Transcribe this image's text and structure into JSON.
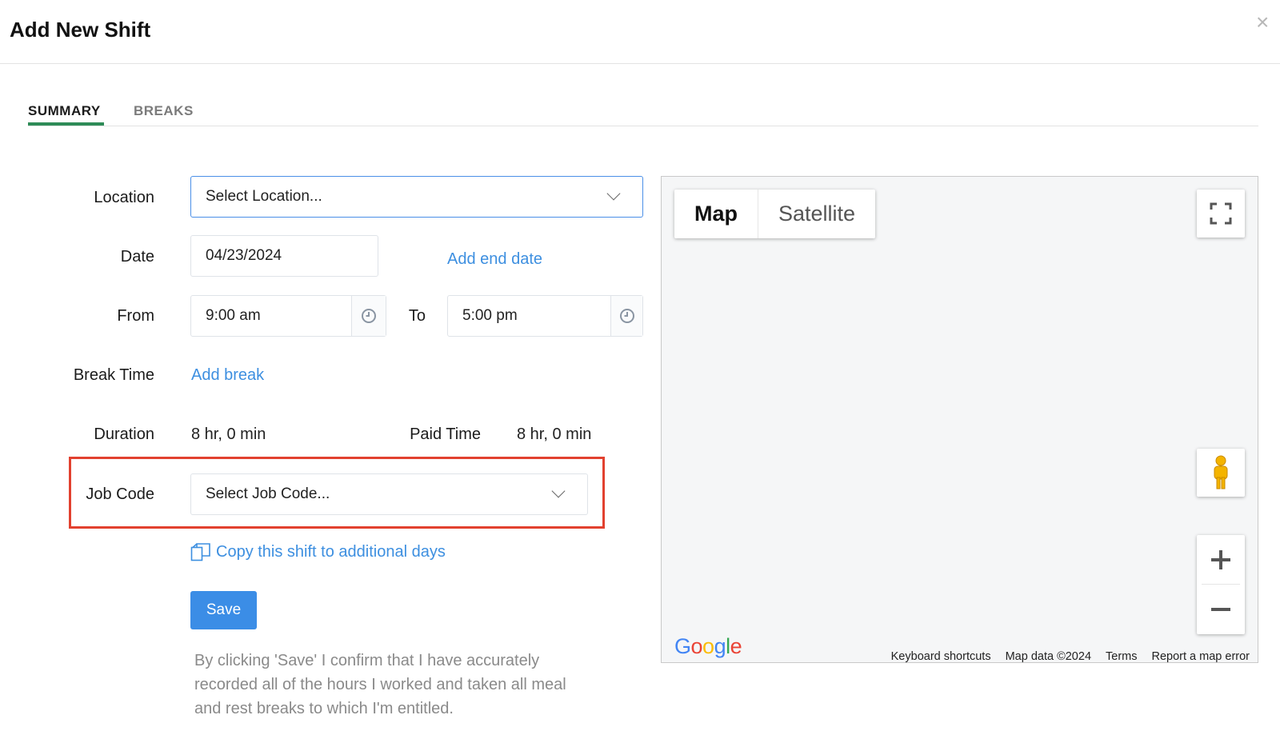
{
  "header": {
    "title": "Add New Shift",
    "close_symbol": "×"
  },
  "tabs": [
    {
      "label": "SUMMARY",
      "active": true
    },
    {
      "label": "BREAKS",
      "active": false
    }
  ],
  "form": {
    "location": {
      "label": "Location",
      "placeholder": "Select Location..."
    },
    "date": {
      "label": "Date",
      "value": "04/23/2024",
      "add_end_date": "Add end date"
    },
    "from": {
      "label": "From",
      "value": "9:00 am"
    },
    "to": {
      "label": "To",
      "value": "5:00 pm"
    },
    "break_time": {
      "label": "Break Time",
      "add_break": "Add break"
    },
    "duration": {
      "label": "Duration",
      "value": "8 hr, 0 min"
    },
    "paid_time": {
      "label": "Paid Time",
      "value": "8 hr, 0 min"
    },
    "job_code": {
      "label": "Job Code",
      "placeholder": "Select Job Code..."
    },
    "copy_shift": "Copy this shift to additional days",
    "save_label": "Save",
    "disclaimer": "By clicking 'Save' I confirm that I have accurately recorded all of the hours I worked and taken all meal and rest breaks to which I'm entitled."
  },
  "map": {
    "types": [
      "Map",
      "Satellite"
    ],
    "logo": "Google",
    "footer": [
      "Keyboard shortcuts",
      "Map data ©2024",
      "Terms",
      "Report a map error"
    ]
  },
  "colors": {
    "accent_tab": "#2e8b57",
    "link": "#3d8fe0",
    "save_button": "#3b8de6",
    "highlight": "#e2412f"
  }
}
